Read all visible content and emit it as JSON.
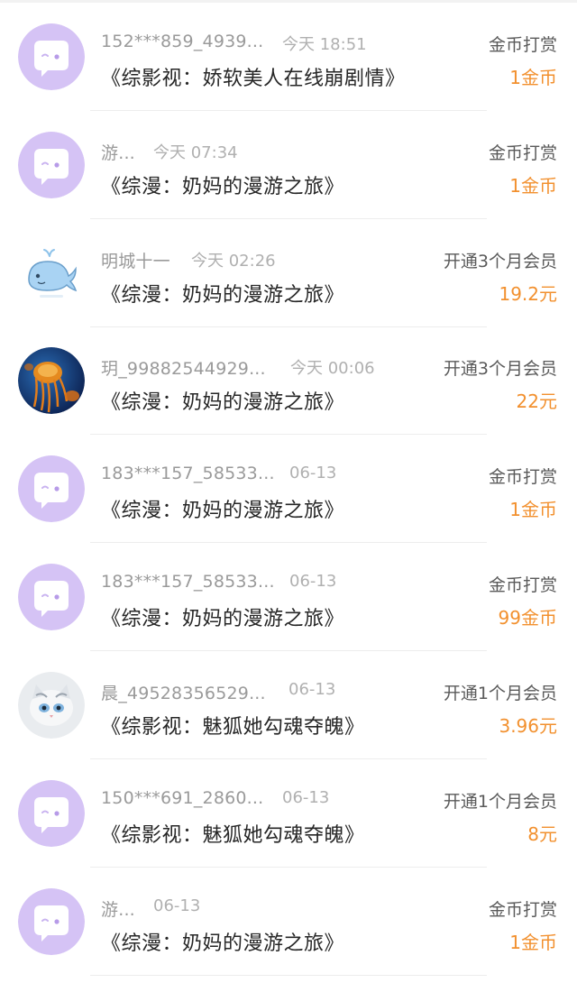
{
  "rewards": [
    {
      "user": "152***859_4939...",
      "time": "今天 18:51",
      "title": "《综影视：娇软美人在线崩剧情》",
      "action": "金币打赏",
      "amount": "1金币",
      "avatar": "chat-bubble-icon"
    },
    {
      "user": "游...",
      "time": "今天 07:34",
      "title": "《综漫：奶妈的漫游之旅》",
      "action": "金币打赏",
      "amount": "1金币",
      "avatar": "chat-bubble-icon"
    },
    {
      "user": "明城十一",
      "time": "今天 02:26",
      "title": "《综漫：奶妈的漫游之旅》",
      "action": "开通3个月会员",
      "amount": "19.2元",
      "avatar": "whale-icon"
    },
    {
      "user": "玥_99882544929...",
      "time": "今天 00:06",
      "title": "《综漫：奶妈的漫游之旅》",
      "action": "开通3个月会员",
      "amount": "22元",
      "avatar": "jellyfish-photo"
    },
    {
      "user": "183***157_58533...",
      "time": "06-13",
      "title": "《综漫：奶妈的漫游之旅》",
      "action": "金币打赏",
      "amount": "1金币",
      "avatar": "chat-bubble-icon"
    },
    {
      "user": "183***157_58533...",
      "time": "06-13",
      "title": "《综漫：奶妈的漫游之旅》",
      "action": "金币打赏",
      "amount": "99金币",
      "avatar": "chat-bubble-icon"
    },
    {
      "user": "晨_49528356529...",
      "time": "06-13",
      "title": "《综影视：魅狐她勾魂夺魄》",
      "action": "开通1个月会员",
      "amount": "3.96元",
      "avatar": "kitten-photo"
    },
    {
      "user": "150***691_2860...",
      "time": "06-13",
      "title": "《综影视：魅狐她勾魂夺魄》",
      "action": "开通1个月会员",
      "amount": "8元",
      "avatar": "chat-bubble-icon"
    },
    {
      "user": "游...",
      "time": "06-13",
      "title": "《综漫：奶妈的漫游之旅》",
      "action": "金币打赏",
      "amount": "1金币",
      "avatar": "chat-bubble-icon"
    }
  ],
  "colors": {
    "amount": "#f2902e",
    "avatar_purple": "#d5c3f5"
  }
}
